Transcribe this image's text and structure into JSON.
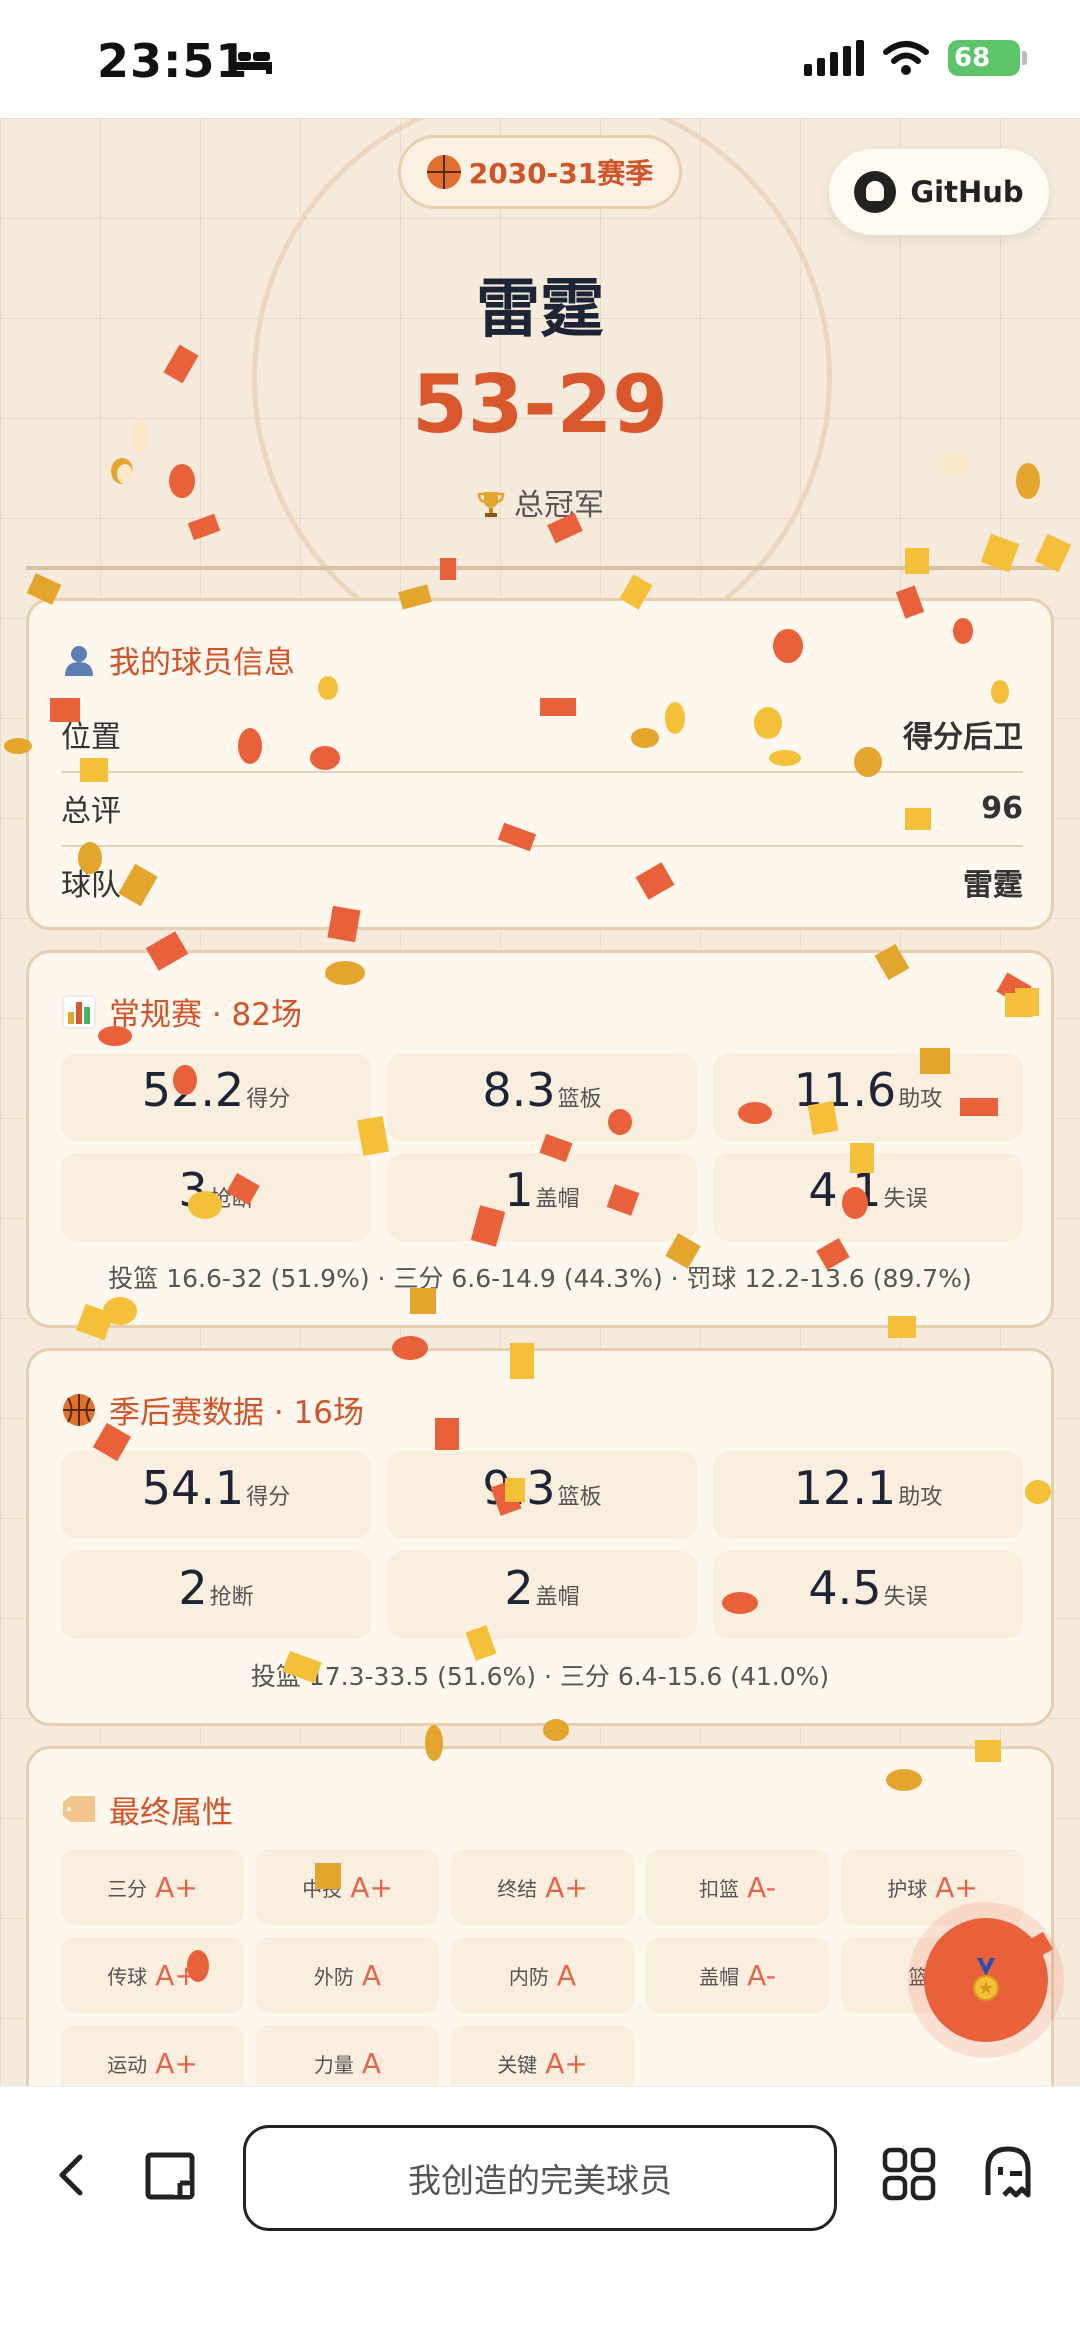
{
  "status_bar": {
    "time": "23:51",
    "battery": "68"
  },
  "header": {
    "season": "2030-31赛季",
    "github_label": "GitHub",
    "team": "雷霆",
    "record": "53-29",
    "result": "总冠军"
  },
  "player_info": {
    "title": "我的球员信息",
    "rows": [
      {
        "label": "位置",
        "value": "得分后卫"
      },
      {
        "label": "总评",
        "value": "96"
      },
      {
        "label": "球队",
        "value": "雷霆"
      }
    ]
  },
  "regular_season": {
    "title": "常规赛 · 82场",
    "stats": [
      {
        "value": "52.2",
        "label": "得分"
      },
      {
        "value": "8.3",
        "label": "篮板"
      },
      {
        "value": "11.6",
        "label": "助攻"
      },
      {
        "value": "3",
        "label": "抢断"
      },
      {
        "value": "1",
        "label": "盖帽"
      },
      {
        "value": "4.1",
        "label": "失误"
      }
    ],
    "shooting": "投篮 16.6-32 (51.9%) · 三分 6.6-14.9 (44.3%) · 罚球 12.2-13.6 (89.7%)"
  },
  "playoffs": {
    "title": "季后赛数据 · 16场",
    "stats": [
      {
        "value": "54.1",
        "label": "得分"
      },
      {
        "value": "9.3",
        "label": "篮板"
      },
      {
        "value": "12.1",
        "label": "助攻"
      },
      {
        "value": "2",
        "label": "抢断"
      },
      {
        "value": "2",
        "label": "盖帽"
      },
      {
        "value": "4.5",
        "label": "失误"
      }
    ],
    "shooting": "投篮 17.3-33.5 (51.6%) · 三分 6.4-15.6 (41.0%)"
  },
  "attributes": {
    "title": "最终属性",
    "items": [
      {
        "label": "三分",
        "grade": "A+"
      },
      {
        "label": "中投",
        "grade": "A+"
      },
      {
        "label": "终结",
        "grade": "A+"
      },
      {
        "label": "扣篮",
        "grade": "A-"
      },
      {
        "label": "护球",
        "grade": "A+"
      },
      {
        "label": "传球",
        "grade": "A+"
      },
      {
        "label": "外防",
        "grade": "A"
      },
      {
        "label": "内防",
        "grade": "A"
      },
      {
        "label": "盖帽",
        "grade": "A-"
      },
      {
        "label": "篮板",
        "grade": ""
      },
      {
        "label": "运动",
        "grade": "A+"
      },
      {
        "label": "力量",
        "grade": "A"
      },
      {
        "label": "关键",
        "grade": "A+"
      }
    ]
  },
  "browser": {
    "url_text": "我创造的完美球员"
  },
  "colors": {
    "accent": "#d9572c",
    "card_bg": "#fdf7ee",
    "fab": "#e8613a"
  }
}
